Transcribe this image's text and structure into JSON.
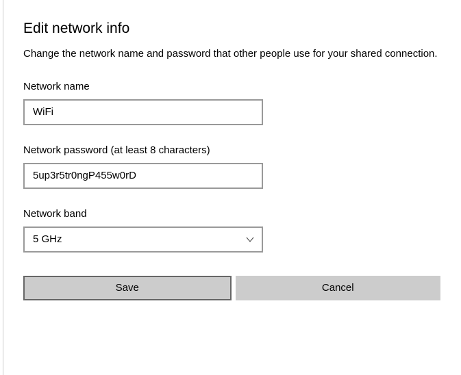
{
  "dialog": {
    "title": "Edit network info",
    "description": "Change the network name and password that other people use for your shared connection."
  },
  "fields": {
    "network_name": {
      "label": "Network name",
      "value": "WiFi"
    },
    "network_password": {
      "label": "Network password (at least 8 characters)",
      "value": "5up3r5tr0ngP455w0rD"
    },
    "network_band": {
      "label": "Network band",
      "value": "5 GHz"
    }
  },
  "buttons": {
    "save": "Save",
    "cancel": "Cancel"
  }
}
